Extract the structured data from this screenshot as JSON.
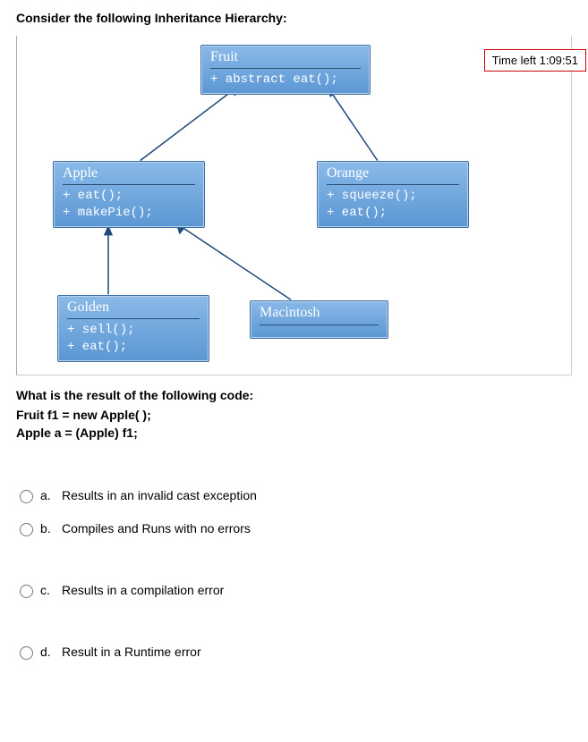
{
  "heading": "Consider the following Inheritance Hierarchy:",
  "timer": "Time left 1:09:51",
  "uml": {
    "fruit": {
      "name": "Fruit",
      "methods": [
        "+ abstract eat();"
      ]
    },
    "apple": {
      "name": "Apple",
      "methods": [
        "+ eat();",
        "+ makePie();"
      ]
    },
    "orange": {
      "name": "Orange",
      "methods": [
        "+ squeeze();",
        "+ eat();"
      ]
    },
    "golden": {
      "name": "Golden",
      "methods": [
        "+ sell();",
        "+ eat();"
      ]
    },
    "macintosh": {
      "name": "Macintosh",
      "methods": []
    }
  },
  "question": {
    "prompt": "What is the result of the following code:",
    "code1": "Fruit  f1 = new  Apple( );",
    "code2": "Apple   a  =  (Apple) f1;"
  },
  "options": {
    "a": {
      "letter": "a.",
      "text": "Results in an invalid cast exception"
    },
    "b": {
      "letter": "b.",
      "text": "Compiles and Runs with no errors"
    },
    "c": {
      "letter": "c.",
      "text": "Results in a compilation error"
    },
    "d": {
      "letter": "d.",
      "text": "Result in a Runtime error"
    }
  }
}
